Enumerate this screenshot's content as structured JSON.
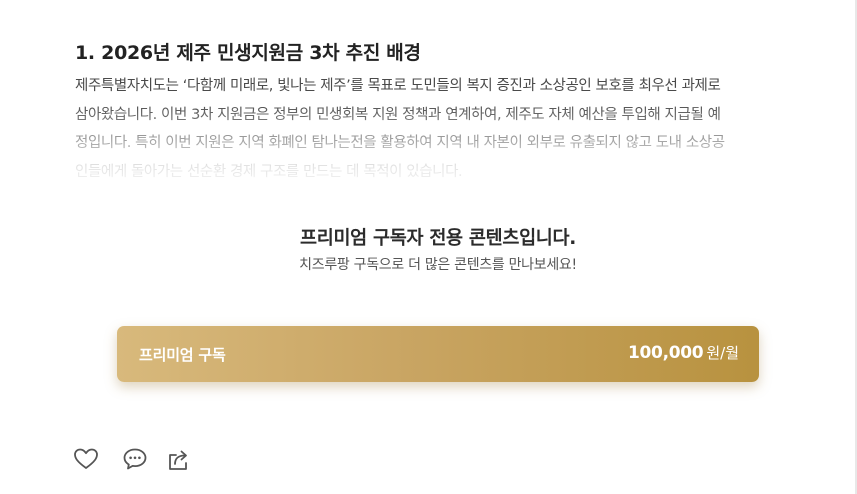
{
  "article": {
    "heading": "1. 2026년 제주 민생지원금 3차 추진 배경",
    "paragraph_line1": "제주특별자치도는 ‘다함께 미래로, 빛나는 제주’를 목표로 도민들의 복지 증진과 소상공인 보호를 최우선 과제로",
    "paragraph_line2": "삼아왔습니다. 이번 3차 지원금은 정부의 민생회복 지원 정책과 연계하여, 제주도 자체 예산을 투입해 지급될 예",
    "paragraph_line3": "정입니다. 특히 이번 지원은 지역 화폐인 탐나는전을 활용하여 지역 내 자본이 외부로 유출되지 않고 도내 소상공",
    "paragraph_line4": "인들에게 돌아가는 선순환 경제 구조를 만드는 데 목적이 있습니다."
  },
  "paywall": {
    "title": "프리미엄 구독자 전용 콘텐츠입니다.",
    "subtitle": "치즈루팡 구독으로 더 많은 콘텐츠를 만나보세요!",
    "subscribe_label": "프리미엄 구독",
    "price_amount": "100,000",
    "price_unit": "원/월",
    "accent_gradient": [
      "#d8b97c",
      "#c9a563",
      "#b8923f"
    ]
  },
  "actions": {
    "icons": [
      "heart-icon",
      "comment-icon",
      "share-icon"
    ]
  }
}
